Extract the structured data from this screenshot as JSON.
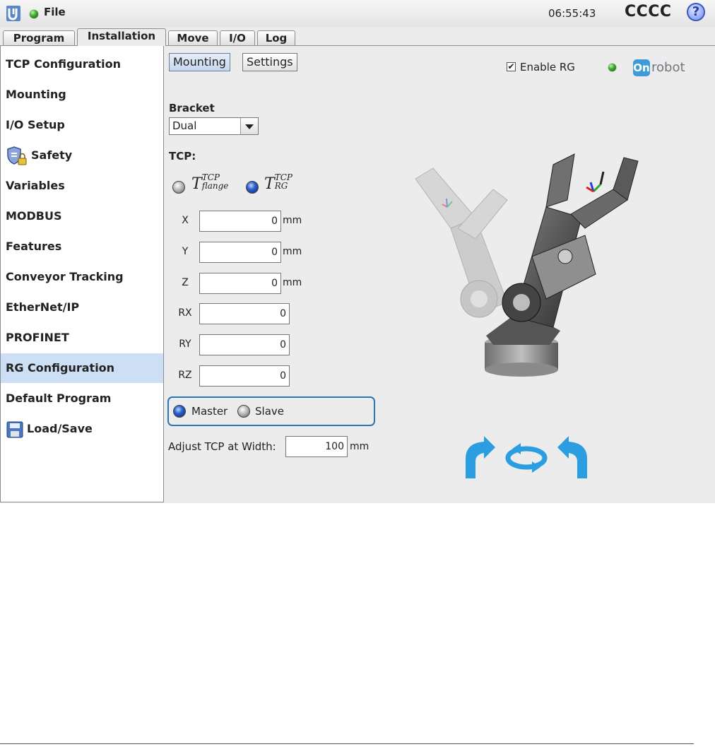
{
  "titlebar": {
    "file_menu": "File",
    "clock": "06:55:43",
    "robot_name": "CCCC",
    "help": "?"
  },
  "tabs": [
    {
      "label": "Program"
    },
    {
      "label": "Installation",
      "active": true
    },
    {
      "label": "Move"
    },
    {
      "label": "I/O"
    },
    {
      "label": "Log"
    }
  ],
  "sidebar": {
    "items": [
      {
        "label": "TCP Configuration"
      },
      {
        "label": "Mounting"
      },
      {
        "label": "I/O Setup"
      },
      {
        "label": "Safety",
        "icon": "shield-lock-icon"
      },
      {
        "label": "Variables"
      },
      {
        "label": "MODBUS"
      },
      {
        "label": "Features"
      },
      {
        "label": "Conveyor Tracking"
      },
      {
        "label": "EtherNet/IP"
      },
      {
        "label": "PROFINET"
      },
      {
        "label": "RG Configuration",
        "selected": true
      },
      {
        "label": "Default Program"
      },
      {
        "label": "Load/Save",
        "icon": "floppy-disk-icon"
      }
    ]
  },
  "main": {
    "subtabs": {
      "mounting": "Mounting",
      "settings": "Settings"
    },
    "enable_rg": {
      "label": "Enable RG",
      "checked": true,
      "check_mark": "✔"
    },
    "onrobot": {
      "mark": "On",
      "text": "robot",
      "color": "#3f9bd8"
    },
    "bracket": {
      "label": "Bracket",
      "value": "Dual"
    },
    "tcp": {
      "label": "TCP:",
      "flange": {
        "base": "T",
        "sup": "TCP",
        "sub": "flange",
        "selected": false
      },
      "rg": {
        "base": "T",
        "sup": "TCP",
        "sub": "RG",
        "selected": true
      }
    },
    "coords": [
      {
        "label": "X",
        "value": "0",
        "unit": "mm"
      },
      {
        "label": "Y",
        "value": "0",
        "unit": "mm"
      },
      {
        "label": "Z",
        "value": "0",
        "unit": "mm"
      },
      {
        "label": "RX",
        "value": "0"
      },
      {
        "label": "RY",
        "value": "0"
      },
      {
        "label": "RZ",
        "value": "0"
      }
    ],
    "role": {
      "master": "Master",
      "slave": "Slave",
      "selected": "Master"
    },
    "adjust": {
      "label": "Adjust TCP at Width:",
      "value": "100",
      "unit": "mm"
    }
  },
  "colors": {
    "accent": "#2a74b8",
    "rotate_arrows": "#2a9ee0",
    "selected_row": "#ccdff5"
  }
}
